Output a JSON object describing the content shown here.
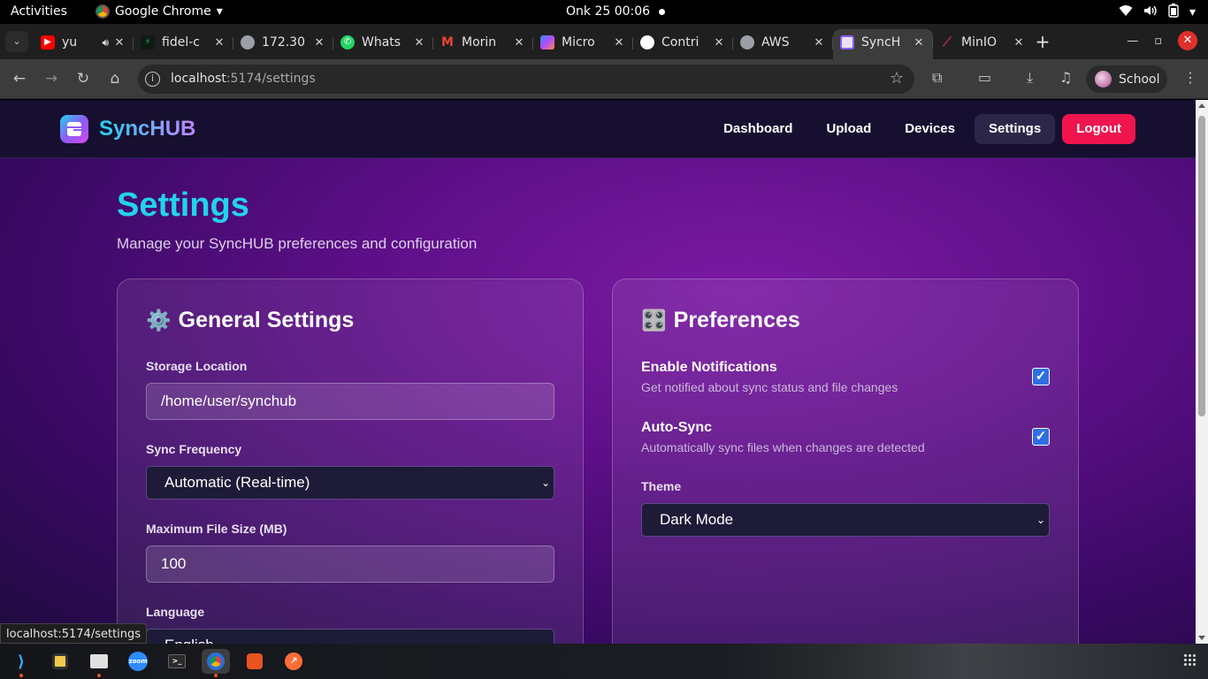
{
  "system_bar": {
    "activities": "Activities",
    "app_name": "Google Chrome",
    "clock": "Onk 25  00:06"
  },
  "browser": {
    "tabs": [
      {
        "title": "yu",
        "icon": "youtube-icon",
        "color": "#ff0000"
      },
      {
        "title": "fidel-c",
        "icon": "bolt-icon",
        "color": "#1db954"
      },
      {
        "title": "172.30",
        "icon": "globe-icon",
        "color": "#9aa0a6"
      },
      {
        "title": "Whats",
        "icon": "whatsapp-icon",
        "color": "#25d366"
      },
      {
        "title": "Morin",
        "icon": "gmail-icon",
        "color": "#ea4335"
      },
      {
        "title": "Micro",
        "icon": "copilot-icon",
        "color": "#7b61ff"
      },
      {
        "title": "Contri",
        "icon": "github-icon",
        "color": "#ffffff"
      },
      {
        "title": "AWS",
        "icon": "globe-icon",
        "color": "#9aa0a6"
      },
      {
        "title": "SyncH",
        "icon": "synchub-icon",
        "color": "#8b5cf6"
      },
      {
        "title": "MinIO",
        "icon": "minio-icon",
        "color": "#c72c48"
      }
    ],
    "address": {
      "host": "localhost",
      "path": ":5174/settings"
    },
    "profile_name": "School",
    "status_tooltip": "localhost:5174/settings"
  },
  "app": {
    "brand": "SyncHUB",
    "nav": [
      "Dashboard",
      "Upload",
      "Devices",
      "Settings"
    ],
    "logout": "Logout",
    "active_nav": "Settings"
  },
  "page": {
    "title": "Settings",
    "subtitle": "Manage your SyncHUB preferences and configuration"
  },
  "general": {
    "heading": "General Settings",
    "icon": "gear-icon",
    "storage_label": "Storage Location",
    "storage_value": "/home/user/synchub",
    "sync_label": "Sync Frequency",
    "sync_value": "Automatic (Real-time)",
    "max_size_label": "Maximum File Size (MB)",
    "max_size_value": "100",
    "language_label": "Language",
    "language_value": "English"
  },
  "preferences": {
    "heading": "Preferences",
    "icon": "control-knobs-icon",
    "notifications_title": "Enable Notifications",
    "notifications_desc": "Get notified about sync status and file changes",
    "notifications_checked": true,
    "autosync_title": "Auto-Sync",
    "autosync_desc": "Automatically sync files when changes are detected",
    "autosync_checked": true,
    "theme_label": "Theme",
    "theme_value": "Dark Mode"
  },
  "colors": {
    "accent_cyan": "#22d3ee",
    "logout_red": "#f0154f",
    "checkbox_blue": "#2f6fe4"
  }
}
